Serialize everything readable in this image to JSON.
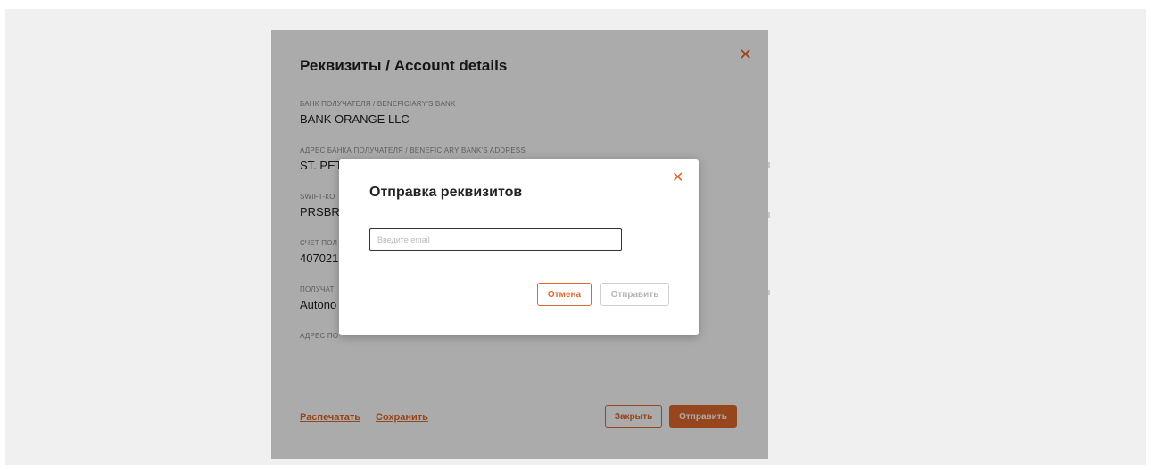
{
  "details": {
    "title": "Реквизиты / Account details",
    "fields": [
      {
        "label": "БАНК ПОЛУЧАТЕЛЯ / BENEFICIARY'S BANK",
        "value": "BANK ORANGE LLC"
      },
      {
        "label": "АДРЕС БАНКА ПОЛУЧАТЕЛЯ / BENEFICIARY BANK'S ADDRESS",
        "value": "ST. PET"
      },
      {
        "label": "SWIFT-КО",
        "value": "PRSBR"
      },
      {
        "label": "СЧЕТ ПОЛ",
        "value": "407021"
      },
      {
        "label": "ПОЛУЧАТ",
        "value": "Autono"
      },
      {
        "label": "АДРЕС ПО",
        "value": ""
      }
    ],
    "print_label": "Распечатать",
    "save_label": "Сохранить",
    "close_label": "Закрыть",
    "send_label": "Отправить",
    "close_icon": "close-icon"
  },
  "dialog": {
    "title": "Отправка реквизитов",
    "email_placeholder": "Введите email",
    "email_value": "",
    "cancel_label": "Отмена",
    "submit_label": "Отправить",
    "close_icon": "close-icon"
  },
  "colors": {
    "accent": "#e0672b",
    "overlay": "rgba(0,0,0,0.33)",
    "background": "#f0f0f0"
  }
}
